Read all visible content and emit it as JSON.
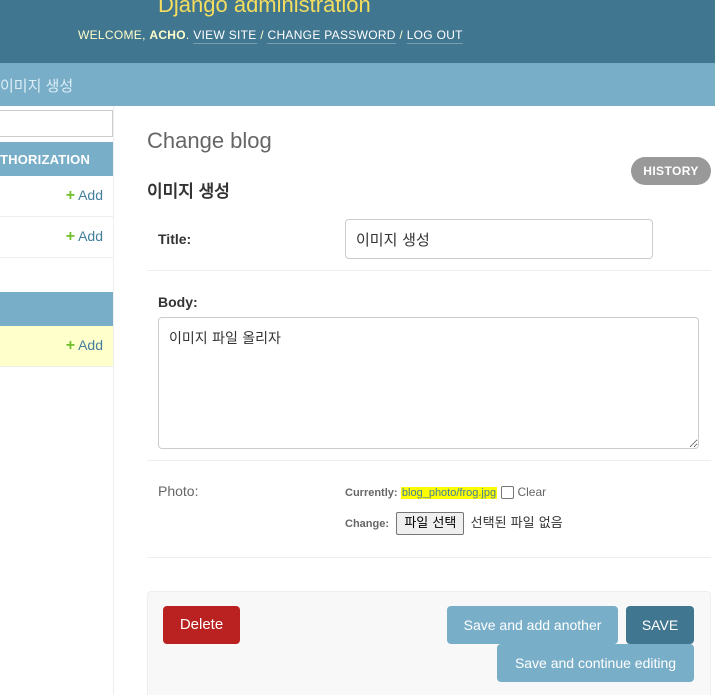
{
  "header": {
    "branding": "Django administration",
    "welcome": "WELCOME, ",
    "username": "ACHO",
    "view_site": "VIEW SITE",
    "change_password": "CHANGE PASSWORD",
    "log_out": "LOG OUT"
  },
  "breadcrumbs": {
    "current": "이미지 생성"
  },
  "sidebar": {
    "sections": [
      {
        "caption": "THORIZATION",
        "rows": [
          {
            "add_label": "Add"
          },
          {
            "add_label": "Add"
          }
        ]
      },
      {
        "caption": "",
        "rows": [
          {
            "add_label": "Add",
            "current": true
          }
        ]
      }
    ]
  },
  "content": {
    "page_title": "Change blog",
    "history": "HISTORY",
    "object_title": "이미지 생성",
    "fields": {
      "title": {
        "label": "Title:",
        "value": "이미지 생성"
      },
      "body": {
        "label": "Body:",
        "value": "이미지 파일 올리자"
      },
      "photo": {
        "label": "Photo:",
        "currently_label": "Currently:",
        "current_file": "blog_photo/frog.jpg",
        "clear_label": "Clear",
        "change_label": "Change:",
        "choose_file": "파일 선택",
        "no_file": "선택된 파일 없음"
      }
    },
    "actions": {
      "delete": "Delete",
      "save_add_another": "Save and add another",
      "save": "Save",
      "save_continue": "Save and continue editing"
    }
  },
  "colors": {
    "header_bg": "#417690",
    "breadcrumbs_bg": "#79aec8",
    "branding": "#f5dd5d",
    "delete": "#ba2121",
    "add_plus": "#70bf2b",
    "file_highlight": "#ffff00"
  }
}
